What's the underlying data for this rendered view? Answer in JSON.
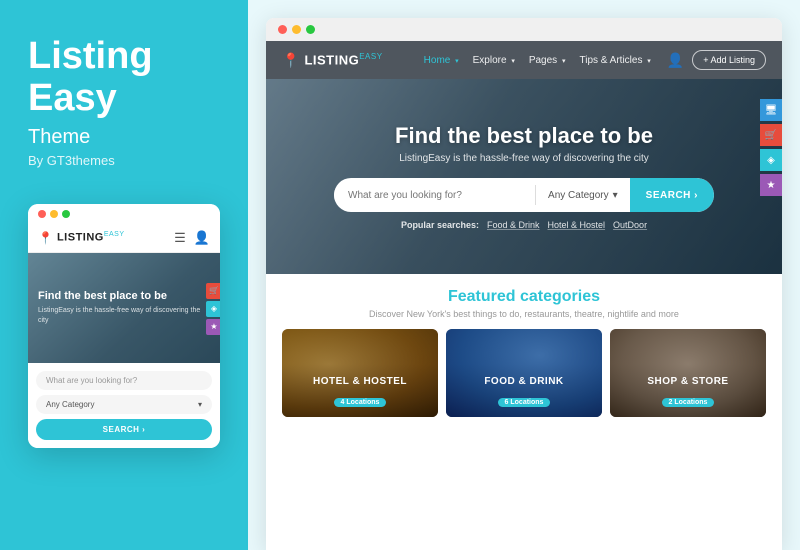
{
  "left": {
    "brand_line1": "Listing",
    "brand_line2": "Easy",
    "subtitle": "Theme",
    "by": "By GT3themes",
    "mobile": {
      "dots": [
        "red",
        "yellow",
        "green"
      ],
      "logo_text": "LISTING",
      "logo_easy": "EASY",
      "nav_icon1": "☰",
      "nav_icon2": "👤",
      "hero_title": "Find the best place to be",
      "hero_sub": "ListingEasy is the hassle-free way of discovering the city",
      "search_placeholder": "What are you looking for?",
      "category_label": "Any Category",
      "search_btn": "SEARCH ›",
      "side_icons": [
        "🛒",
        "◈",
        "★"
      ]
    }
  },
  "right": {
    "desktop": {
      "dots": [
        "red",
        "yellow",
        "green"
      ],
      "logo_text": "LISTING",
      "logo_easy": "EASY",
      "nav_links": [
        {
          "label": "Home",
          "active": true,
          "has_chevron": true
        },
        {
          "label": "Explore",
          "active": false,
          "has_chevron": true
        },
        {
          "label": "Pages",
          "active": false,
          "has_chevron": true
        },
        {
          "label": "Tips & Articles",
          "active": false,
          "has_chevron": true
        }
      ],
      "add_listing_btn": "+ Add Listing",
      "hero_title": "Find the best place to be",
      "hero_sub": "ListingEasy is the hassle-free way of discovering the city",
      "search_placeholder": "What are you looking for?",
      "category_label": "Any Category",
      "search_btn": "SEARCH ›",
      "popular_label": "Popular searches:",
      "popular_tags": [
        "Food & Drink",
        "Hotel & Hostel",
        "OutDoor"
      ],
      "side_icons": [
        {
          "icon": "🖥",
          "type": "monitor"
        },
        {
          "icon": "🛒",
          "type": "cart"
        },
        {
          "icon": "◈",
          "type": "share"
        },
        {
          "icon": "★",
          "type": "star"
        }
      ],
      "featured_title": "Featured categories",
      "featured_sub": "Discover New York's best things to do, restaurants, theatre, nightlife and more",
      "cards": [
        {
          "title": "HOTEL & HOSTEL",
          "badge": "4 Locations",
          "type": "hotel"
        },
        {
          "title": "FOOD & DRINK",
          "badge": "6 Locations",
          "type": "food"
        },
        {
          "title": "SHOP & STORE",
          "badge": "2 Locations",
          "type": "shop"
        }
      ]
    }
  }
}
